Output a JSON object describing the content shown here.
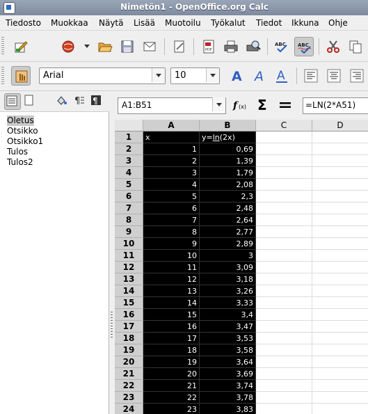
{
  "window": {
    "title": "Nimetön1 - OpenOffice.org Calc"
  },
  "menu": [
    "Tiedosto",
    "Muokkaa",
    "Näytä",
    "Lisää",
    "Muotoilu",
    "Työkalut",
    "Tiedot",
    "Ikkuna",
    "Ohje"
  ],
  "format": {
    "font_name": "Arial",
    "font_size": "10"
  },
  "styles": {
    "items": [
      "Oletus",
      "Otsikko",
      "Otsikko1",
      "Tulos",
      "Tulos2"
    ],
    "selected": "Oletus"
  },
  "formula_bar": {
    "cell_ref": "A1:B51",
    "formula": "=LN(2*A51)"
  },
  "sheet": {
    "columns": [
      "A",
      "B",
      "C",
      "D"
    ],
    "header_row": {
      "a": "x",
      "b_prefix": "y=",
      "b_fn": "ln",
      "b_suffix": "(2x)"
    },
    "rows": [
      {
        "n": "1"
      },
      {
        "n": "2",
        "a": "1",
        "b": "0,69"
      },
      {
        "n": "3",
        "a": "2",
        "b": "1,39"
      },
      {
        "n": "4",
        "a": "3",
        "b": "1,79"
      },
      {
        "n": "5",
        "a": "4",
        "b": "2,08"
      },
      {
        "n": "6",
        "a": "5",
        "b": "2,3"
      },
      {
        "n": "7",
        "a": "6",
        "b": "2,48"
      },
      {
        "n": "8",
        "a": "7",
        "b": "2,64"
      },
      {
        "n": "9",
        "a": "8",
        "b": "2,77"
      },
      {
        "n": "10",
        "a": "9",
        "b": "2,89"
      },
      {
        "n": "11",
        "a": "10",
        "b": "3"
      },
      {
        "n": "12",
        "a": "11",
        "b": "3,09"
      },
      {
        "n": "13",
        "a": "12",
        "b": "3,18"
      },
      {
        "n": "14",
        "a": "13",
        "b": "3,26"
      },
      {
        "n": "15",
        "a": "14",
        "b": "3,33"
      },
      {
        "n": "16",
        "a": "15",
        "b": "3,4"
      },
      {
        "n": "17",
        "a": "16",
        "b": "3,47"
      },
      {
        "n": "18",
        "a": "17",
        "b": "3,53"
      },
      {
        "n": "19",
        "a": "18",
        "b": "3,58"
      },
      {
        "n": "20",
        "a": "19",
        "b": "3,64"
      },
      {
        "n": "21",
        "a": "20",
        "b": "3,69"
      },
      {
        "n": "22",
        "a": "21",
        "b": "3,74"
      },
      {
        "n": "23",
        "a": "22",
        "b": "3,78"
      },
      {
        "n": "24",
        "a": "23",
        "b": "3,83"
      }
    ]
  },
  "colors": {
    "selection": "#000000",
    "titlebar": "#8a96aa",
    "header": "#e5e5e5"
  }
}
